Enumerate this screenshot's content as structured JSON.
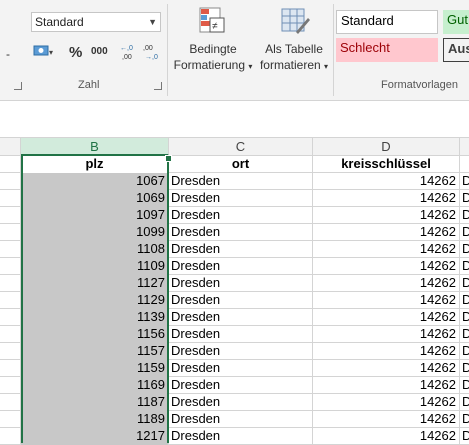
{
  "ribbon": {
    "number_format": "Standard",
    "percent_label": "%",
    "thousands_label": "000",
    "dec_increase_label": "←,0 ,00",
    "dec_decrease_label": ",00 →,0",
    "zahl_group_label": "Zahl",
    "cond_format_line1": "Bedingte",
    "cond_format_line2": "Formatierung",
    "table_format_line1": "Als Tabelle",
    "table_format_line2": "formatieren",
    "styles_group_label": "Formatvorlagen",
    "styles": {
      "standard": "Standard",
      "gut": "Gut",
      "schlecht": "Schlecht",
      "ausgabe": "Aus"
    },
    "colors": {
      "gut_bg": "#c6efce",
      "gut_fg": "#006100",
      "schlecht_bg": "#ffc7ce",
      "schlecht_fg": "#9c0006",
      "accent": "#217346"
    }
  },
  "columns": {
    "b": "B",
    "c": "C",
    "d": "D"
  },
  "header_row": {
    "b": "plz",
    "c": "ort",
    "d": "kreisschlüssel"
  },
  "rows": [
    {
      "plz": "1067",
      "ort": "Dresden",
      "kreis": "14262",
      "e": "D"
    },
    {
      "plz": "1069",
      "ort": "Dresden",
      "kreis": "14262",
      "e": "D"
    },
    {
      "plz": "1097",
      "ort": "Dresden",
      "kreis": "14262",
      "e": "D"
    },
    {
      "plz": "1099",
      "ort": "Dresden",
      "kreis": "14262",
      "e": "D"
    },
    {
      "plz": "1108",
      "ort": "Dresden",
      "kreis": "14262",
      "e": "D"
    },
    {
      "plz": "1109",
      "ort": "Dresden",
      "kreis": "14262",
      "e": "D"
    },
    {
      "plz": "1127",
      "ort": "Dresden",
      "kreis": "14262",
      "e": "D"
    },
    {
      "plz": "1129",
      "ort": "Dresden",
      "kreis": "14262",
      "e": "D"
    },
    {
      "plz": "1139",
      "ort": "Dresden",
      "kreis": "14262",
      "e": "D"
    },
    {
      "plz": "1156",
      "ort": "Dresden",
      "kreis": "14262",
      "e": "D"
    },
    {
      "plz": "1157",
      "ort": "Dresden",
      "kreis": "14262",
      "e": "D"
    },
    {
      "plz": "1159",
      "ort": "Dresden",
      "kreis": "14262",
      "e": "D"
    },
    {
      "plz": "1169",
      "ort": "Dresden",
      "kreis": "14262",
      "e": "D"
    },
    {
      "plz": "1187",
      "ort": "Dresden",
      "kreis": "14262",
      "e": "D"
    },
    {
      "plz": "1189",
      "ort": "Dresden",
      "kreis": "14262",
      "e": "D"
    },
    {
      "plz": "1217",
      "ort": "Dresden",
      "kreis": "14262",
      "e": "D"
    }
  ]
}
